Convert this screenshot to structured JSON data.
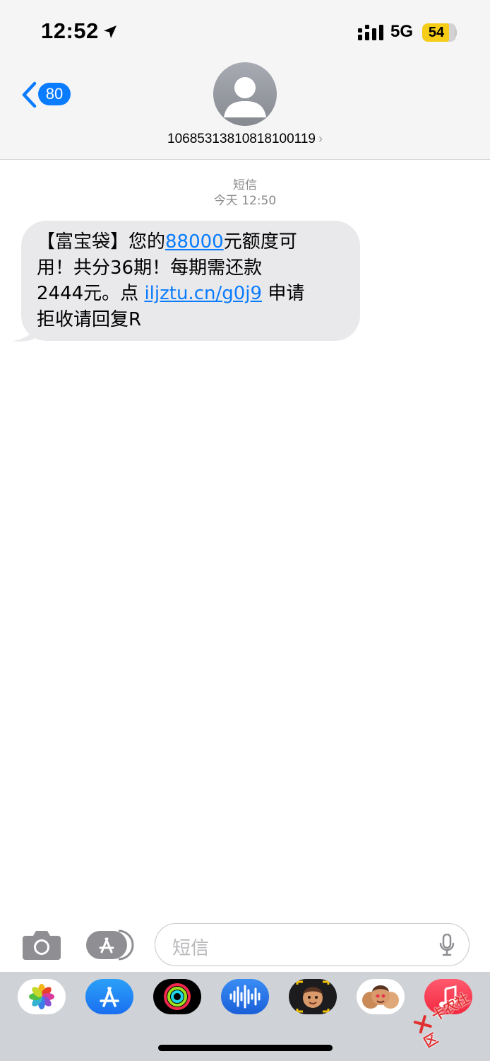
{
  "status_bar": {
    "time": "12:52",
    "network": "5G",
    "battery": "54",
    "battery_level": 0.54
  },
  "header": {
    "back_badge": "80",
    "sender": "10685313810818100119"
  },
  "conversation": {
    "label": "短信",
    "timestamp": "今天 12:50"
  },
  "message": {
    "line1_a": "【富宝袋】您的",
    "amount_link": "88000",
    "line1_b": "元额度可",
    "line2": "用！共分36期！每期需还款",
    "line3_a": "2444元。点",
    "url_link": "iljztu.cn/g0j9",
    "line3_b": "申请",
    "line4": "拒收请回复R"
  },
  "input": {
    "placeholder": "短信"
  },
  "app_drawer": {
    "apps": [
      "photos-icon",
      "app-store-icon",
      "activity-icon",
      "audio-message-icon",
      "memoji-icon",
      "memoji-stickers-icon",
      "music-icon"
    ]
  },
  "watermark": {
    "text": "卡农社区"
  },
  "colors": {
    "accent": "#0a7cff",
    "bubble": "#e9e9eb",
    "header_bg": "#f5f5f5",
    "drawer_bg": "#cfd2d7",
    "battery_fill": "#f5cd16"
  }
}
